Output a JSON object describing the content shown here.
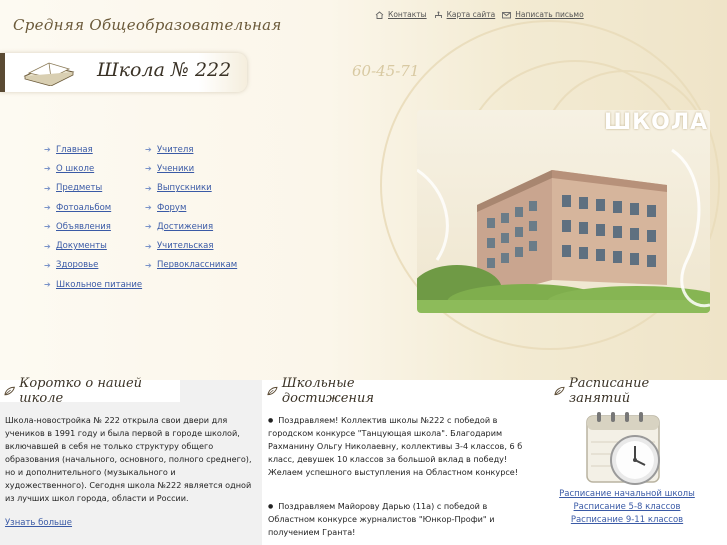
{
  "header": {
    "subtitle": "Средняя  Общеобразовательная",
    "school_name": "Школа № 222",
    "phone": "60-45-71",
    "photo_label": "ШКОЛА"
  },
  "toplinks": [
    {
      "label": "Контакты",
      "icon": "home-icon"
    },
    {
      "label": "Карта сайта",
      "icon": "sitemap-icon"
    },
    {
      "label": "Написать письмо",
      "icon": "mail-icon"
    }
  ],
  "nav": {
    "col1": [
      "Главная",
      "О школе",
      "Предметы",
      "Фотоальбом",
      "Объявления",
      "Документы",
      "Здоровье",
      "Школьное питание"
    ],
    "col2": [
      "Учителя",
      "Ученики",
      "Выпускники",
      "Форум",
      "Достижения",
      "Учительская",
      "Первоклассникам"
    ]
  },
  "about": {
    "title": "Коротко о нашей школе",
    "text": "Школа-новостройка   №   222 открыла свои двери для учеников в  1991 году и была первой в городе школой, включавшей в себя не только структуру общего образования  (начального, основного, полного среднего), но и дополнительного  (музыкального и художественного). Сегодня школа  №222 является одной из лучших школ города, области и России.",
    "more_link": "Узнать больше"
  },
  "achievements": {
    "title": "Школьные достижения",
    "items": [
      "Поздравляем! Коллектив школы №222 с победой в городском конкурсе \"Танцующая школа\". Благодарим Рахманину Ольгу Николаевну, коллективы 3-4 классов, 6 б класс, девушек 10 классов за большой вклад в победу! Желаем успешного выступления на Областном конкурсе!",
      "Поздравляем Майорову Дарью (11а) с победой в Областном конкурсе журналистов \"Юнкор-Профи\" и получением Гранта!"
    ]
  },
  "schedule": {
    "title": "Расписание занятий",
    "links": [
      "Расписание начальной школы",
      "Расписание 5-8 классов",
      "Расписание 9-11 классов"
    ]
  },
  "colors": {
    "link": "#3a5aa6",
    "background": "#fbf6ea",
    "accent": "#5a4a33"
  }
}
